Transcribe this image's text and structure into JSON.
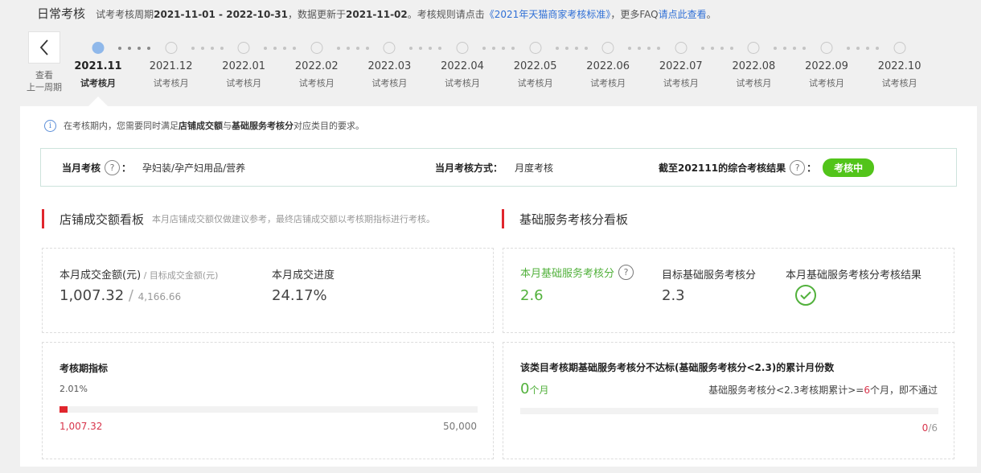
{
  "header": {
    "title": "日常考核",
    "period_prefix": "试考考核周期",
    "period_range": "2021-11-01 - 2022-10-31",
    "update_prefix": "，数据更新于",
    "update_date": "2021-11-02",
    "rule_prefix": "。考核规则请点击",
    "rule_link": "《2021年天猫商家考核标准》",
    "faq_prefix": "，更多FAQ",
    "faq_link": "请点此查看",
    "faq_suffix": "。"
  },
  "prev_period": {
    "line1": "查看",
    "line2": "上一周期",
    "icon": "chevron-left-icon"
  },
  "timeline": [
    {
      "month": "2021.11",
      "sub": "试考核月",
      "active": true
    },
    {
      "month": "2021.12",
      "sub": "试考核月",
      "active": false
    },
    {
      "month": "2022.01",
      "sub": "试考核月",
      "active": false
    },
    {
      "month": "2022.02",
      "sub": "试考核月",
      "active": false
    },
    {
      "month": "2022.03",
      "sub": "试考核月",
      "active": false
    },
    {
      "month": "2022.04",
      "sub": "试考核月",
      "active": false
    },
    {
      "month": "2022.05",
      "sub": "试考核月",
      "active": false
    },
    {
      "month": "2022.06",
      "sub": "试考核月",
      "active": false
    },
    {
      "month": "2022.07",
      "sub": "试考核月",
      "active": false
    },
    {
      "month": "2022.08",
      "sub": "试考核月",
      "active": false
    },
    {
      "month": "2022.09",
      "sub": "试考核月",
      "active": false
    },
    {
      "month": "2022.10",
      "sub": "试考核月",
      "active": false
    }
  ],
  "tip": {
    "pre": "在考核期内，您需要同时满足",
    "b1": "店铺成交额",
    "mid": "与",
    "b2": "基础服务考核分",
    "post": "对应类目的要求。"
  },
  "summary": {
    "month_label": "当月考核",
    "month_colon": "：",
    "category": "孕妇装/孕产妇用品/营养",
    "method_label": "当月考核方式：",
    "method_value": "月度考核",
    "result_label": "截至202111的综合考核结果",
    "result_colon": "：",
    "result_badge": "考核中",
    "badge_color": "#52c41a"
  },
  "shop": {
    "title": "店铺成交额看板",
    "note": "本月店铺成交额仅做建议参考，最终店铺成交额以考核期指标进行考核。",
    "amount_label": "本月成交金额(元)",
    "sep": " / ",
    "target_label": "目标成交金额(元)",
    "amount_value": "1,007.32",
    "target_value": "4,166.66",
    "progress_label": "本月成交进度",
    "progress_value": "24.17%",
    "indicator_title": "考核期指标",
    "indicator_percent": "2.01%",
    "indicator_progress": 0.0201,
    "indicator_current": "1,007.32",
    "indicator_target": "50,000"
  },
  "service": {
    "title": "基础服务考核分看板",
    "score_label": "本月基础服务考核分",
    "score_value": "2.6",
    "target_label": "目标基础服务考核分",
    "target_value": "2.3",
    "result_label": "本月基础服务考核分考核结果",
    "result_icon": "check-circle-icon",
    "fail_title": "该类目考核期基础服务考核分不达标(基础服务考核分<2.3)的累计月份数",
    "fail_count": "0",
    "fail_unit": "个月",
    "fail_rule_pre": "基础服务考核分<2.3考核期累计>=",
    "fail_rule_num": "6",
    "fail_rule_post": "个月，即不通过",
    "fail_progress": 0,
    "fail_ratio_num": "0",
    "fail_ratio_den": "/6"
  },
  "colors": {
    "accent_red": "#e0262d",
    "green": "#52b13c",
    "link_blue": "#3070d6",
    "active_dot": "#8fb8ea"
  }
}
